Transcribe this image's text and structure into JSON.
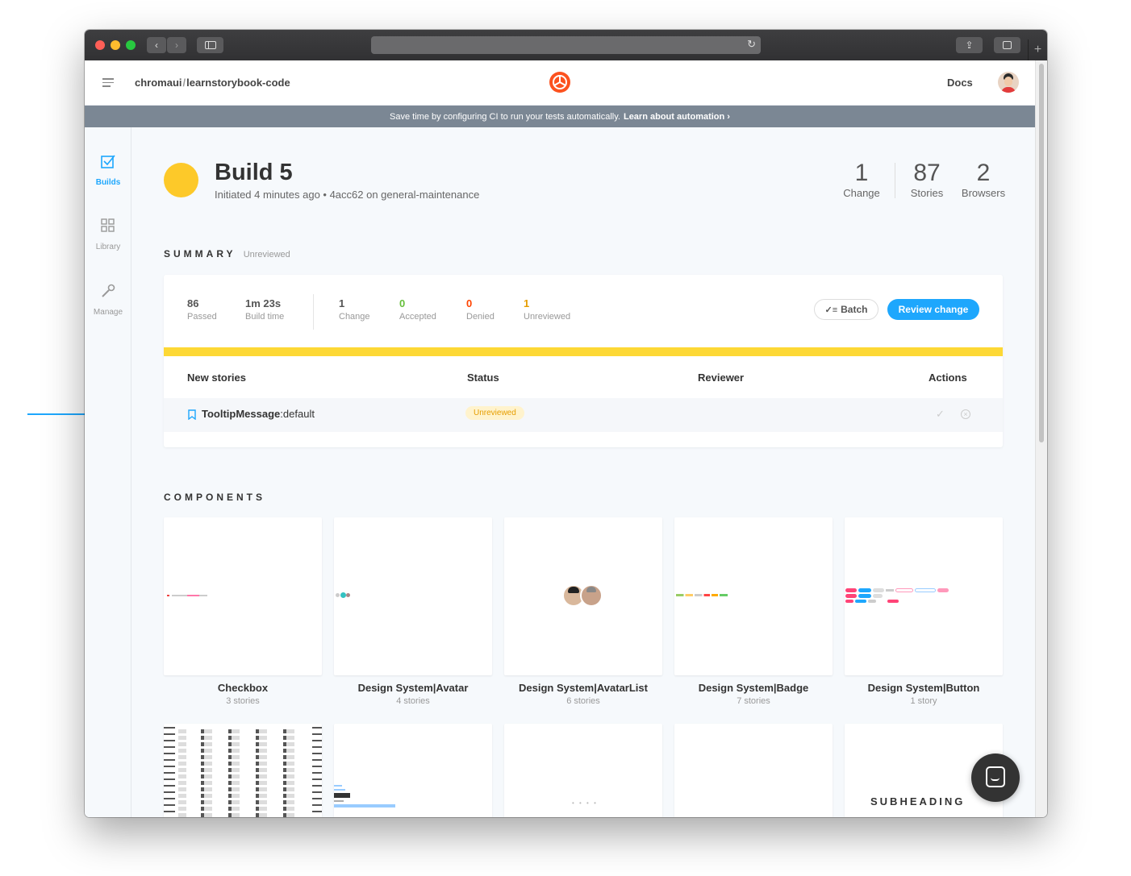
{
  "header": {
    "repo": "chromaui",
    "separator": "/",
    "project": "learnstorybook-code",
    "docs_label": "Docs"
  },
  "banner": {
    "text": "Save time by configuring CI to run your tests automatically.",
    "link": "Learn about automation ›"
  },
  "sidebar": {
    "items": [
      {
        "label": "Builds",
        "icon": "checkbox-icon"
      },
      {
        "label": "Library",
        "icon": "grid-icon"
      },
      {
        "label": "Manage",
        "icon": "wrench-icon"
      }
    ]
  },
  "build": {
    "title": "Build 5",
    "subtitle": "Initiated 4 minutes ago • 4acc62 on general-maintenance",
    "status_color": "#fdc929",
    "stats": [
      {
        "value": "1",
        "label": "Change"
      },
      {
        "value": "87",
        "label": "Stories"
      },
      {
        "value": "2",
        "label": "Browsers"
      }
    ]
  },
  "summary": {
    "heading": "SUMMARY",
    "status": "Unreviewed",
    "metrics": [
      {
        "value": "86",
        "label": "Passed",
        "color": "#333333"
      },
      {
        "value": "1m 23s",
        "label": "Build time",
        "color": "#333333"
      },
      {
        "value": "1",
        "label": "Change",
        "color": "#333333"
      },
      {
        "value": "0",
        "label": "Accepted",
        "color": "#66bf3c"
      },
      {
        "value": "0",
        "label": "Denied",
        "color": "#ff4400"
      },
      {
        "value": "1",
        "label": "Unreviewed",
        "color": "#e69d00"
      }
    ],
    "batch_label": "Batch",
    "review_label": "Review change",
    "table": {
      "headers": [
        "New stories",
        "Status",
        "Reviewer",
        "Actions"
      ],
      "rows": [
        {
          "component": "TooltipMessage",
          "separator": ":",
          "story": "default",
          "status": "Unreviewed"
        }
      ]
    }
  },
  "components": {
    "heading": "COMPONENTS",
    "items": [
      {
        "title": "Checkbox",
        "count": "3 stories"
      },
      {
        "title": "Design System|Avatar",
        "count": "4 stories"
      },
      {
        "title": "Design System|AvatarList",
        "count": "6 stories"
      },
      {
        "title": "Design System|Badge",
        "count": "7 stories"
      },
      {
        "title": "Design System|Button",
        "count": "1 story"
      }
    ],
    "subheading_preview": "SUBHEADING"
  },
  "colors": {
    "accent": "#1ea7fd",
    "warning_bar": "#fdd835",
    "arrow": "#1ea7fd"
  }
}
